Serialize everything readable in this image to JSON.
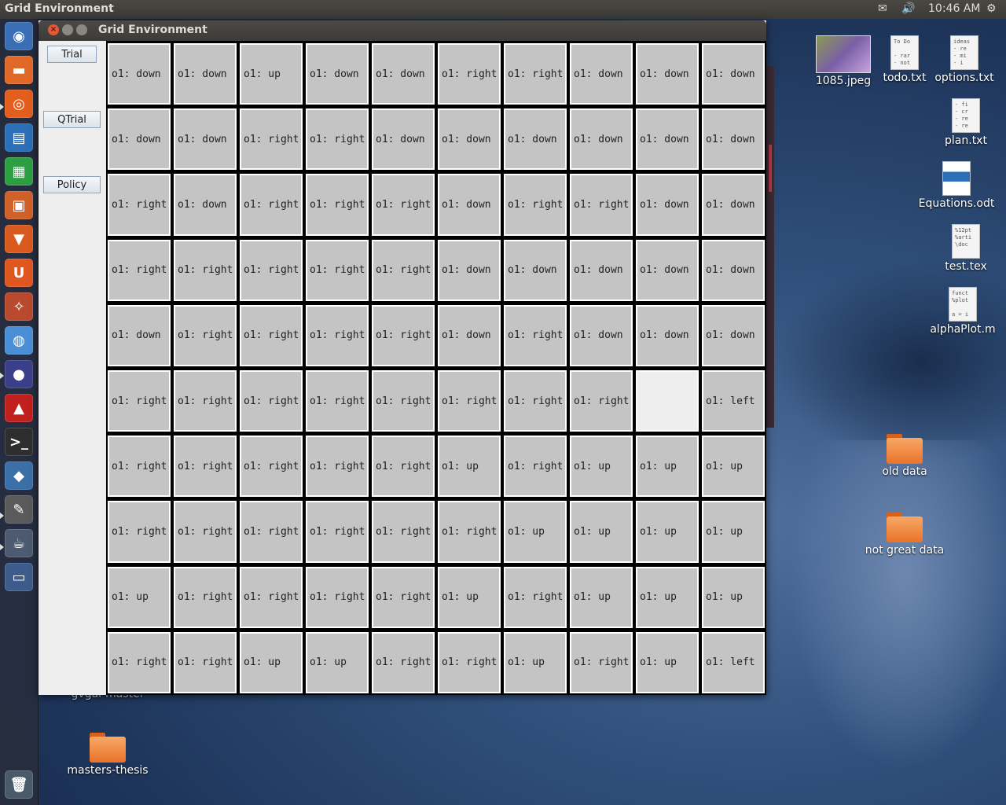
{
  "top_panel": {
    "app_title": "Grid Environment",
    "mail_icon": "✉",
    "sound_icon": "🔊",
    "clock": "10:46 AM",
    "settings_icon": "⚙"
  },
  "launcher": {
    "items": [
      {
        "name": "dash-icon",
        "glyph": "◉",
        "color": "#3b6fb5"
      },
      {
        "name": "files-icon",
        "glyph": "▬",
        "color": "#e0692a"
      },
      {
        "name": "firefox-icon",
        "glyph": "◎",
        "color": "#e35d1c"
      },
      {
        "name": "writer-icon",
        "glyph": "▤",
        "color": "#2a6fb8"
      },
      {
        "name": "calc-icon",
        "glyph": "▦",
        "color": "#2e9e43"
      },
      {
        "name": "impress-icon",
        "glyph": "▣",
        "color": "#d0602a"
      },
      {
        "name": "software-center-icon",
        "glyph": "▼",
        "color": "#d85a1e"
      },
      {
        "name": "ubuntu-one-icon",
        "glyph": "U",
        "color": "#e0561f"
      },
      {
        "name": "system-settings-icon",
        "glyph": "✧",
        "color": "#b94a30"
      },
      {
        "name": "chrome-icon",
        "glyph": "◍",
        "color": "#4a8fd6"
      },
      {
        "name": "eclipse-icon",
        "glyph": "●",
        "color": "#3a3f8a"
      },
      {
        "name": "acrobat-icon",
        "glyph": "▲",
        "color": "#c0201e"
      },
      {
        "name": "terminal-icon",
        "glyph": ">_",
        "color": "#2e2e2e"
      },
      {
        "name": "matlab-icon",
        "glyph": "◆",
        "color": "#3a6fa8"
      },
      {
        "name": "text-editor-icon",
        "glyph": "✎",
        "color": "#5a5a5a"
      },
      {
        "name": "java-app-icon",
        "glyph": "☕",
        "color": "#4d5b70"
      },
      {
        "name": "workspace-switcher-icon",
        "glyph": "▭",
        "color": "#3d5c8c"
      },
      {
        "name": "trash-icon",
        "glyph": "🗑",
        "color": "#4a5a6a"
      }
    ]
  },
  "window": {
    "title": "Grid Environment",
    "close_glyph": "×",
    "buttons": {
      "trial": "Trial",
      "qtrial": "QTrial",
      "policy": "Policy"
    },
    "grid": [
      [
        "o1: down",
        "o1: down",
        "o1: up",
        "o1: down",
        "o1: down",
        "o1: right",
        "o1: right",
        "o1: down",
        "o1: down",
        "o1: down"
      ],
      [
        "o1: down",
        "o1: down",
        "o1: right",
        "o1: right",
        "o1: down",
        "o1: down",
        "o1: down",
        "o1: down",
        "o1: down",
        "o1: down"
      ],
      [
        "o1: right",
        "o1: down",
        "o1: right",
        "o1: right",
        "o1: right",
        "o1: down",
        "o1: right",
        "o1: right",
        "o1: down",
        "o1: down"
      ],
      [
        "o1: right",
        "o1: right",
        "o1: right",
        "o1: right",
        "o1: right",
        "o1: down",
        "o1: down",
        "o1: down",
        "o1: down",
        "o1: down"
      ],
      [
        "o1: down",
        "o1: right",
        "o1: right",
        "o1: right",
        "o1: right",
        "o1: down",
        "o1: right",
        "o1: down",
        "o1: down",
        "o1: down"
      ],
      [
        "o1: right",
        "o1: right",
        "o1: right",
        "o1: right",
        "o1: right",
        "o1: right",
        "o1: right",
        "o1: right",
        "",
        "o1: left"
      ],
      [
        "o1: right",
        "o1: right",
        "o1: right",
        "o1: right",
        "o1: right",
        "o1: up",
        "o1: right",
        "o1: up",
        "o1: up",
        "o1: up"
      ],
      [
        "o1: right",
        "o1: right",
        "o1: right",
        "o1: right",
        "o1: right",
        "o1: right",
        "o1: up",
        "o1: up",
        "o1: up",
        "o1: up"
      ],
      [
        "o1: up",
        "o1: right",
        "o1: right",
        "o1: right",
        "o1: right",
        "o1: up",
        "o1: right",
        "o1: up",
        "o1: up",
        "o1: up"
      ],
      [
        "o1: right",
        "o1: right",
        "o1: up",
        "o1: up",
        "o1: right",
        "o1: right",
        "o1: up",
        "o1: right",
        "o1: up",
        "o1: left"
      ]
    ]
  },
  "desktop": {
    "icons": [
      {
        "name": "image-file-icon",
        "label": "1085.jpeg",
        "kind": "image",
        "preview": ""
      },
      {
        "name": "text-file-icon",
        "label": "todo.txt",
        "kind": "doc",
        "preview": "To Do\n\n- rar\n- not"
      },
      {
        "name": "text-file-icon",
        "label": "options.txt",
        "kind": "doc",
        "preview": "ideas\n- re\n- mi\n- i"
      },
      {
        "name": "text-file-icon",
        "label": "plan.txt",
        "kind": "doc",
        "preview": "- fi\n- cr\n- re\n- re"
      },
      {
        "name": "odt-file-icon",
        "label": "Equations.odt",
        "kind": "odt",
        "preview": ""
      },
      {
        "name": "tex-file-icon",
        "label": "test.tex",
        "kind": "doc",
        "preview": "%12pt\n%arti\n\\doc"
      },
      {
        "name": "m-file-icon",
        "label": "alphaPlot.m",
        "kind": "doc",
        "preview": "funct\n%plot\n\na = i"
      },
      {
        "name": "folder-icon",
        "label": "old data",
        "kind": "folder",
        "preview": ""
      },
      {
        "name": "folder-icon",
        "label": "not great data",
        "kind": "folder",
        "preview": ""
      },
      {
        "name": "folder-label-partial",
        "label": "gvgai-master",
        "kind": "label",
        "preview": ""
      },
      {
        "name": "folder-icon",
        "label": "masters-thesis",
        "kind": "folder",
        "preview": ""
      }
    ]
  }
}
